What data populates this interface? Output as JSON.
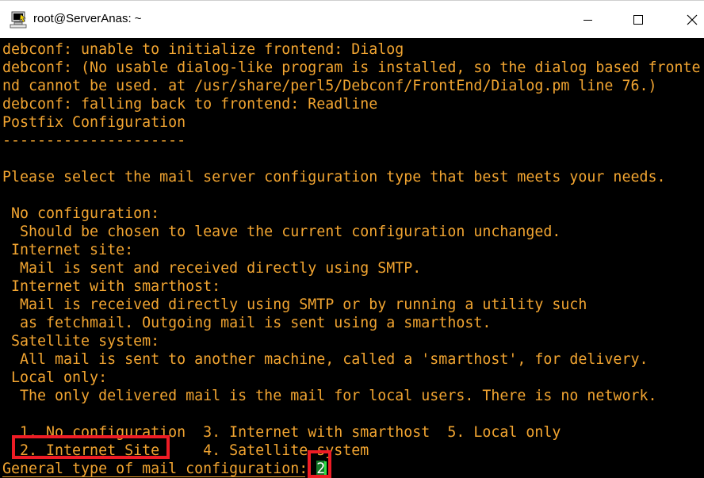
{
  "window": {
    "title": "root@ServerAnas: ~",
    "icon": "putty-terminal-icon",
    "controls": {
      "minimize": "minimize-icon",
      "maximize": "maximize-icon",
      "close": "close-icon"
    }
  },
  "terminal": {
    "lines": [
      "debconf: unable to initialize frontend: Dialog",
      "debconf: (No usable dialog-like program is installed, so the dialog based fronte",
      "nd cannot be used. at /usr/share/perl5/Debconf/FrontEnd/Dialog.pm line 76.)",
      "debconf: falling back to frontend: Readline",
      "Postfix Configuration",
      "---------------------",
      "",
      "Please select the mail server configuration type that best meets your needs.",
      "",
      " No configuration:",
      "  Should be chosen to leave the current configuration unchanged.",
      " Internet site:",
      "  Mail is sent and received directly using SMTP.",
      " Internet with smarthost:",
      "  Mail is received directly using SMTP or by running a utility such",
      "  as fetchmail. Outgoing mail is sent using a smarthost.",
      " Satellite system:",
      "  All mail is sent to another machine, called a 'smarthost', for delivery.",
      " Local only:",
      "  The only delivered mail is the mail for local users. There is no network.",
      "",
      "  1. No configuration  3. Internet with smarthost  5. Local only",
      "  2. Internet Site     4. Satellite system"
    ],
    "prompt": "General type of mail configuration: ",
    "answer": "2"
  },
  "colors": {
    "terminal_text": "#f2a531",
    "terminal_bg": "#000000",
    "highlight_box": "#ee1c25",
    "cursor": "#2ee045"
  }
}
